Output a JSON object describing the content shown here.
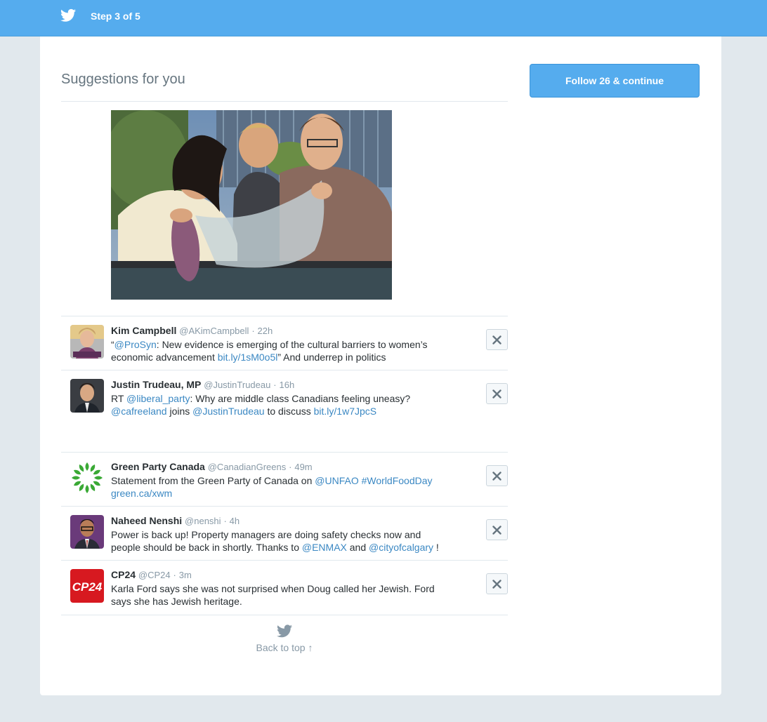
{
  "topbar": {
    "logo_icon": "twitter-bird-icon",
    "step_label": "Step 3 of 5"
  },
  "main": {
    "heading": "Suggestions for you",
    "follow_button": "Follow 26 & continue"
  },
  "feed": {
    "tweets": [
      {
        "name": "Kim Campbell",
        "handle": "@AKimCampbell",
        "sep": "·",
        "time": "22h",
        "parts": [
          "“",
          "@ProSyn",
          ": New evidence is emerging of the cultural barriers to women’s economic advancement ",
          "bit.ly/1sM0o5l",
          "” And underrep in politics"
        ]
      },
      {
        "name": "Justin Trudeau, MP",
        "handle": "@JustinTrudeau",
        "sep": "·",
        "time": "16h",
        "parts": [
          "RT ",
          "@liberal_party",
          ": Why are middle class Canadians feeling uneasy? ",
          "@cafreeland",
          " joins ",
          "@JustinTrudeau",
          " to discuss ",
          "bit.ly/1w7JpcS"
        ]
      },
      {
        "name": "Green Party Canada",
        "handle": "@CanadianGreens",
        "sep": "·",
        "time": "49m",
        "parts": [
          "Statement from the Green Party of Canada on ",
          "@UNFAO",
          " ",
          "#WorldFoodDay",
          " ",
          "green.ca/xwm"
        ]
      },
      {
        "name": "Naheed Nenshi",
        "handle": "@nenshi",
        "sep": "·",
        "time": "4h",
        "parts": [
          "Power is back up! Property managers are doing safety checks now and people should be back in shortly. Thanks to ",
          "@ENMAX",
          " and ",
          "@cityofcalgary",
          " !"
        ]
      },
      {
        "name": "CP24",
        "handle": "@CP24",
        "sep": "·",
        "time": "3m",
        "parts": [
          "Karla Ford says she was not surprised when Doug called her Jewish. Ford says she has Jewish heritage."
        ]
      }
    ],
    "avatar_badge_cp24": "CP24"
  },
  "footer": {
    "back_to_top": "Back to top ↑"
  },
  "colors": {
    "brand": "#55acee",
    "link": "#3b88c3",
    "muted": "#8899a6"
  }
}
